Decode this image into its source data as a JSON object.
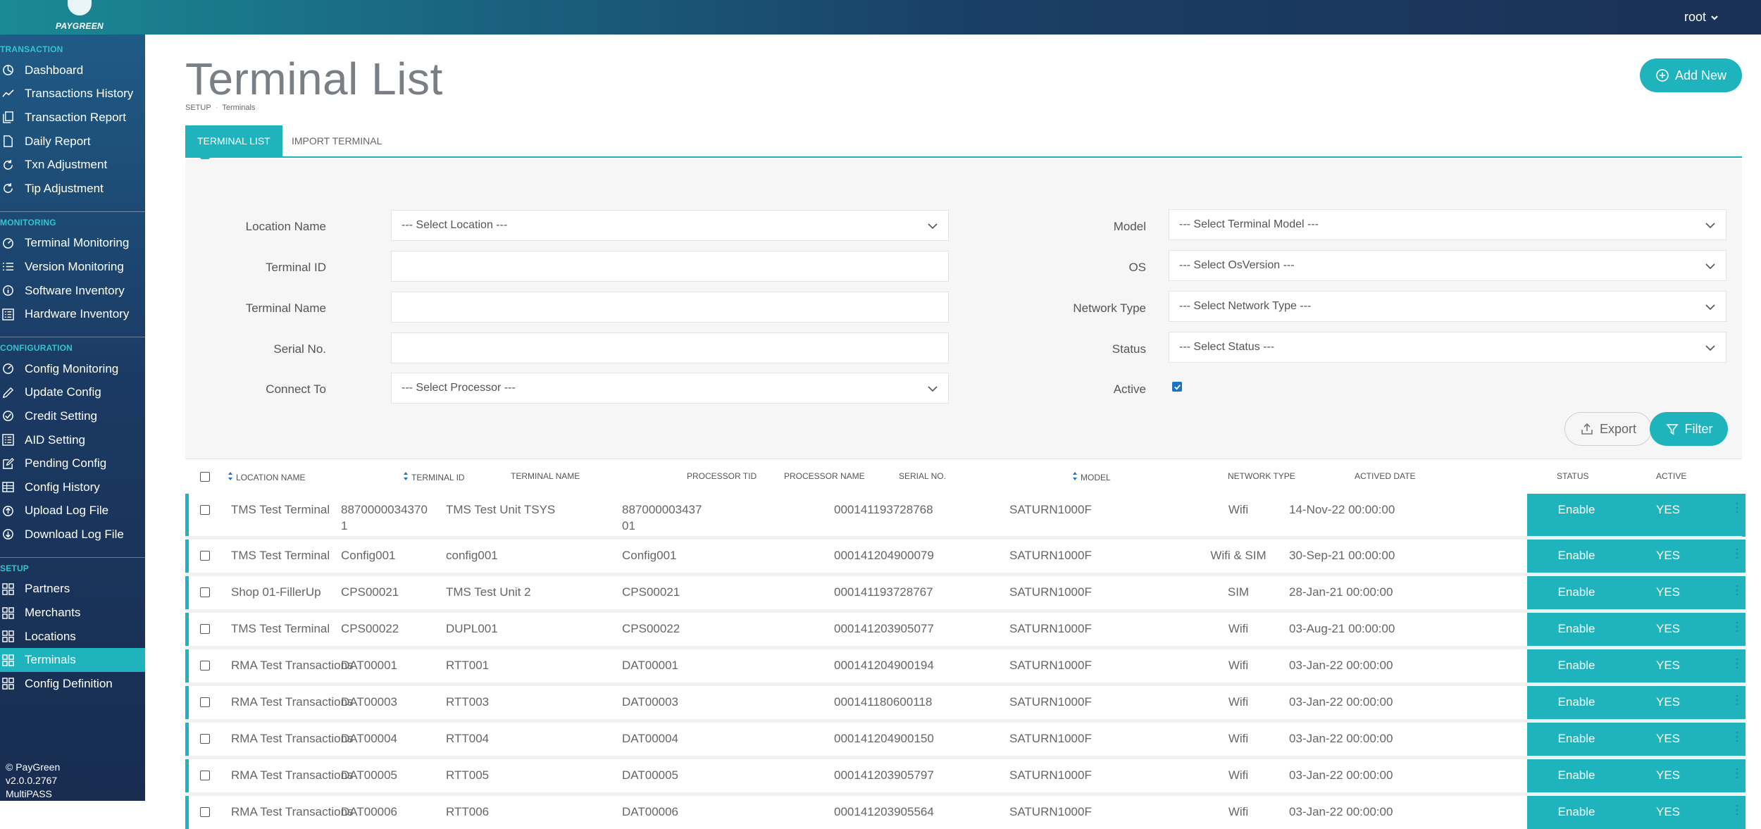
{
  "header": {
    "logo_text": "PAYGREEN",
    "user": "root"
  },
  "sidebar": {
    "sections": [
      {
        "title": "TRANSACTION",
        "items": [
          {
            "label": "Dashboard",
            "icon": "dashboard-icon"
          },
          {
            "label": "Transactions History",
            "icon": "trend-icon"
          },
          {
            "label": "Transaction Report",
            "icon": "copy-icon"
          },
          {
            "label": "Daily Report",
            "icon": "file-icon"
          },
          {
            "label": "Txn Adjustment",
            "icon": "refresh-icon"
          },
          {
            "label": "Tip Adjustment",
            "icon": "refresh-icon"
          }
        ]
      },
      {
        "title": "MONITORING",
        "items": [
          {
            "label": "Terminal Monitoring",
            "icon": "gauge-icon"
          },
          {
            "label": "Version Monitoring",
            "icon": "list-icon"
          },
          {
            "label": "Software Inventory",
            "icon": "info-icon"
          },
          {
            "label": "Hardware Inventory",
            "icon": "grid-list-icon"
          }
        ]
      },
      {
        "title": "CONFIGURATION",
        "items": [
          {
            "label": "Config Monitoring",
            "icon": "gauge-icon"
          },
          {
            "label": "Update Config",
            "icon": "pencil-icon"
          },
          {
            "label": "Credit Setting",
            "icon": "check-circle-icon"
          },
          {
            "label": "AID Setting",
            "icon": "grid-list-icon"
          },
          {
            "label": "Pending Config",
            "icon": "edit-icon"
          },
          {
            "label": "Config History",
            "icon": "table-icon"
          },
          {
            "label": "Upload Log File",
            "icon": "upload-icon"
          },
          {
            "label": "Download Log File",
            "icon": "download-icon"
          }
        ]
      },
      {
        "title": "SETUP",
        "items": [
          {
            "label": "Partners",
            "icon": "grid-icon"
          },
          {
            "label": "Merchants",
            "icon": "grid-icon"
          },
          {
            "label": "Locations",
            "icon": "grid-icon"
          },
          {
            "label": "Terminals",
            "icon": "grid-icon",
            "active": true
          },
          {
            "label": "Config Definition",
            "icon": "grid-icon"
          }
        ]
      }
    ],
    "footer": {
      "copyright": "© PayGreen",
      "version": "v2.0.0.2767",
      "product": "MultiPASS"
    }
  },
  "page": {
    "title": "Terminal List",
    "breadcrumb": [
      "SETUP",
      "Terminals"
    ],
    "add_button": "Add New"
  },
  "tabs": [
    {
      "label": "TERMINAL LIST",
      "active": true
    },
    {
      "label": "IMPORT TERMINAL",
      "active": false
    }
  ],
  "filters": {
    "location_name": {
      "label": "Location Name",
      "value": "--- Select Location ---"
    },
    "terminal_id": {
      "label": "Terminal ID",
      "value": ""
    },
    "terminal_name": {
      "label": "Terminal Name",
      "value": ""
    },
    "serial_no": {
      "label": "Serial No.",
      "value": ""
    },
    "connect_to": {
      "label": "Connect To",
      "value": "--- Select Processor ---"
    },
    "model": {
      "label": "Model",
      "value": "--- Select Terminal Model ---"
    },
    "os": {
      "label": "OS",
      "value": "--- Select OsVersion ---"
    },
    "network_type": {
      "label": "Network Type",
      "value": "--- Select Network Type ---"
    },
    "status": {
      "label": "Status",
      "value": "--- Select Status ---"
    },
    "active": {
      "label": "Active",
      "checked": true
    },
    "export_button": "Export",
    "filter_button": "Filter"
  },
  "table": {
    "columns": [
      "LOCATION NAME",
      "TERMINAL ID",
      "TERMINAL NAME",
      "PROCESSOR TID",
      "PROCESSOR NAME",
      "SERIAL NO.",
      "MODEL",
      "NETWORK TYPE",
      "ACTIVED DATE",
      "STATUS",
      "ACTIVE"
    ],
    "rows": [
      {
        "location": "TMS Test Terminal",
        "terminal_id": "8870000034370",
        "terminal_id_2": "1",
        "terminal_name": "TMS Test Unit TSYS",
        "processor_tid": "887000003437",
        "processor_tid_2": "01",
        "processor_name": "",
        "serial": "000141193728768",
        "model": "SATURN1000F",
        "network": "Wifi",
        "date": "14-Nov-22 00:00:00",
        "status": "Enable",
        "active": "YES"
      },
      {
        "location": "TMS Test Terminal",
        "terminal_id": "Config001",
        "terminal_name": "config001",
        "processor_tid": "Config001",
        "processor_name": "",
        "serial": "000141204900079",
        "model": "SATURN1000F",
        "network": "Wifi & SIM",
        "date": "30-Sep-21 00:00:00",
        "status": "Enable",
        "active": "YES"
      },
      {
        "location": "Shop 01-FillerUp",
        "terminal_id": "CPS00021",
        "terminal_name": "TMS Test Unit 2",
        "processor_tid": "CPS00021",
        "processor_name": "",
        "serial": "000141193728767",
        "model": "SATURN1000F",
        "network": "SIM",
        "date": "28-Jan-21 00:00:00",
        "status": "Enable",
        "active": "YES"
      },
      {
        "location": "TMS Test Terminal",
        "terminal_id": "CPS00022",
        "terminal_name": "DUPL001",
        "processor_tid": "CPS00022",
        "processor_name": "",
        "serial": "000141203905077",
        "model": "SATURN1000F",
        "network": "Wifi",
        "date": "03-Aug-21 00:00:00",
        "status": "Enable",
        "active": "YES"
      },
      {
        "location": "RMA Test Transactions",
        "terminal_id": "DAT00001",
        "terminal_name": "RTT001",
        "processor_tid": "DAT00001",
        "processor_name": "",
        "serial": "000141204900194",
        "model": "SATURN1000F",
        "network": "Wifi",
        "date": "03-Jan-22 00:00:00",
        "status": "Enable",
        "active": "YES"
      },
      {
        "location": "RMA Test Transactions",
        "terminal_id": "DAT00003",
        "terminal_name": "RTT003",
        "processor_tid": "DAT00003",
        "processor_name": "",
        "serial": "000141180600118",
        "model": "SATURN1000F",
        "network": "Wifi",
        "date": "03-Jan-22 00:00:00",
        "status": "Enable",
        "active": "YES"
      },
      {
        "location": "RMA Test Transactions",
        "terminal_id": "DAT00004",
        "terminal_name": "RTT004",
        "processor_tid": "DAT00004",
        "processor_name": "",
        "serial": "000141204900150",
        "model": "SATURN1000F",
        "network": "Wifi",
        "date": "03-Jan-22 00:00:00",
        "status": "Enable",
        "active": "YES"
      },
      {
        "location": "RMA Test Transactions",
        "terminal_id": "DAT00005",
        "terminal_name": "RTT005",
        "processor_tid": "DAT00005",
        "processor_name": "",
        "serial": "000141203905797",
        "model": "SATURN1000F",
        "network": "Wifi",
        "date": "03-Jan-22 00:00:00",
        "status": "Enable",
        "active": "YES"
      },
      {
        "location": "RMA Test Transactions",
        "terminal_id": "DAT00006",
        "terminal_name": "RTT006",
        "processor_tid": "DAT00006",
        "processor_name": "",
        "serial": "000141203905564",
        "model": "SATURN1000F",
        "network": "Wifi",
        "date": "03-Jan-22 00:00:00",
        "status": "Enable",
        "active": "YES"
      }
    ]
  },
  "colors": {
    "accent": "#1fb3bd",
    "sidebar_dark": "#182c50",
    "checkbox_blue": "#1a73c9"
  }
}
